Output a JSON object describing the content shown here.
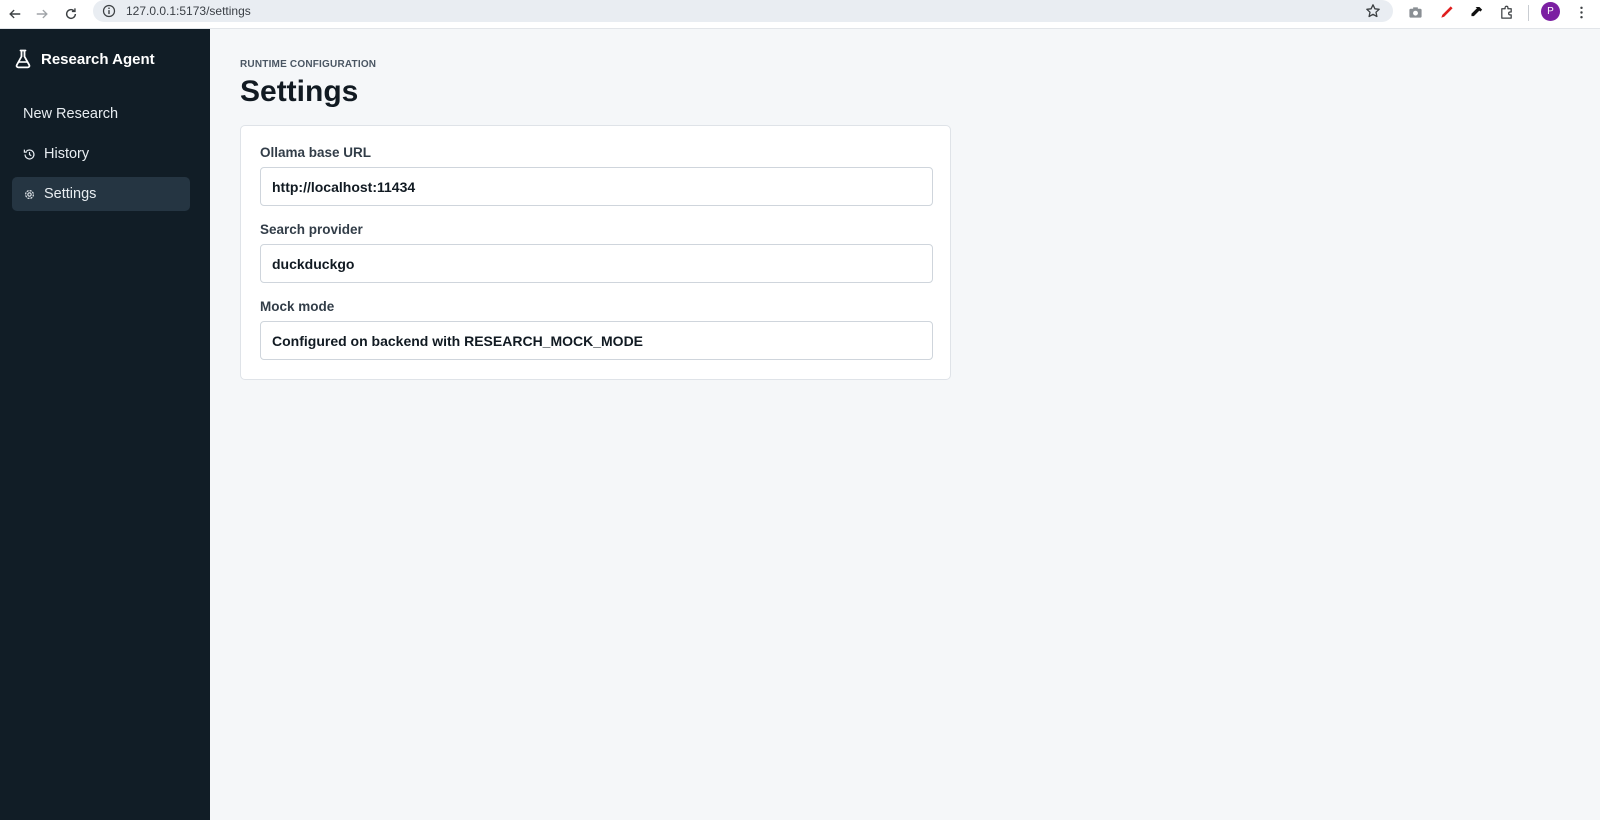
{
  "browser": {
    "url": "127.0.0.1:5173/settings",
    "profile_initial": "P",
    "icons": [
      "back-icon",
      "forward-icon",
      "reload-icon",
      "site-info-icon",
      "bookmark-star-icon",
      "camera-icon",
      "pen-icon",
      "eyedropper-icon",
      "extensions-icon",
      "menu-icon"
    ]
  },
  "sidebar": {
    "brand": "Research Agent",
    "items": [
      {
        "label": "New Research",
        "icon": "",
        "active": false
      },
      {
        "label": "History",
        "icon": "history-icon",
        "active": false
      },
      {
        "label": "Settings",
        "icon": "gear-icon",
        "active": true
      }
    ]
  },
  "main": {
    "eyebrow": "RUNTIME CONFIGURATION",
    "title": "Settings",
    "fields": [
      {
        "label": "Ollama base URL",
        "value": "http://localhost:11434"
      },
      {
        "label": "Search provider",
        "value": "duckduckgo"
      },
      {
        "label": "Mock mode",
        "value": "Configured on backend with RESEARCH_MOCK_MODE"
      }
    ]
  },
  "colors": {
    "sidebar_bg": "#111d26",
    "sidebar_active": "#253542",
    "page_bg": "#f5f7f9",
    "profile": "#7b1fa2"
  }
}
